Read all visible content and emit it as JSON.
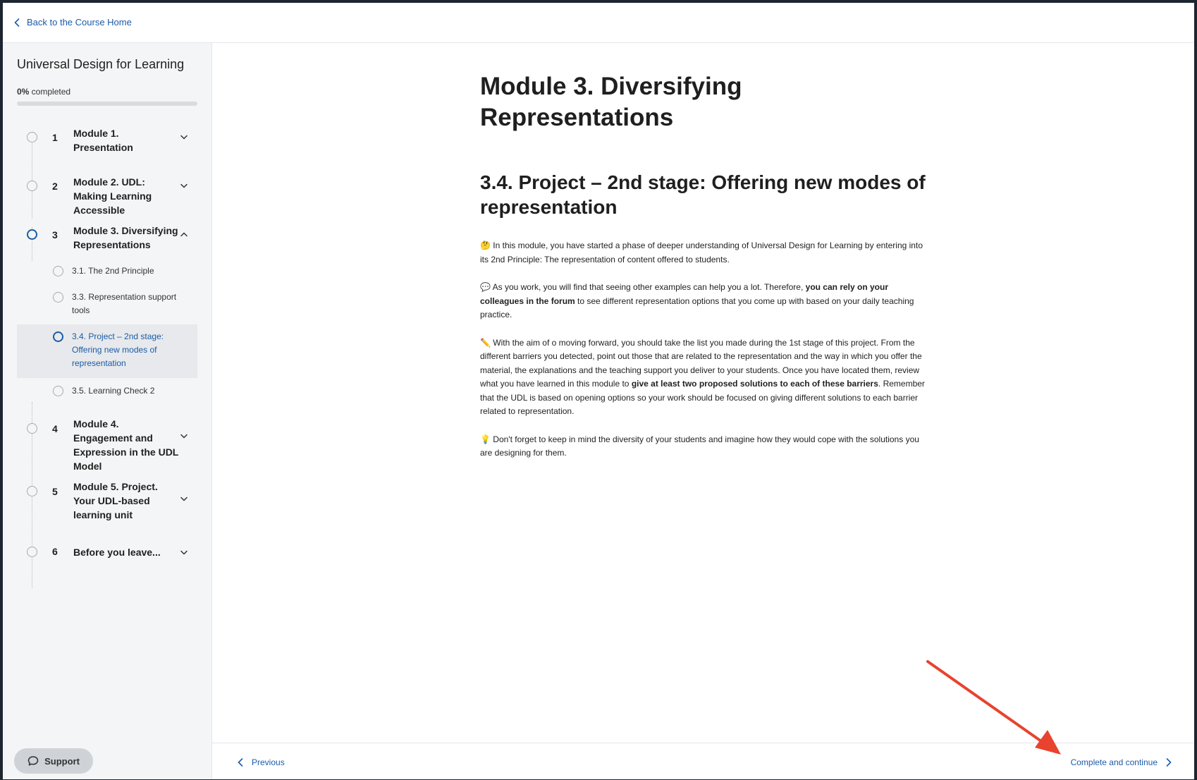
{
  "topbar": {
    "back_label": "Back to the Course Home"
  },
  "sidebar": {
    "course_title": "Universal Design for Learning",
    "progress_percent": "0%",
    "progress_suffix": " completed",
    "progress_value": 0,
    "modules": [
      {
        "num": "1",
        "title": "Module 1. Presentation",
        "expanded": false
      },
      {
        "num": "2",
        "title": "Module 2. UDL: Making Learning Accessible",
        "expanded": false
      },
      {
        "num": "3",
        "title": "Module 3. Diversifying Representations",
        "expanded": true
      },
      {
        "num": "4",
        "title": "Module 4. Engagement and Expression in the UDL Model",
        "expanded": false
      },
      {
        "num": "5",
        "title": "Module 5. Project. Your UDL-based learning unit",
        "expanded": false
      },
      {
        "num": "6",
        "title": "Before you leave...",
        "expanded": false
      }
    ],
    "lessons": [
      {
        "title": "3.1. The 2nd Principle"
      },
      {
        "title": "3.3. Representation support tools"
      },
      {
        "title": "3.4. Project – 2nd stage: Offering new modes of representation",
        "current": true
      },
      {
        "title": "3.5. Learning Check 2"
      }
    ],
    "support_label": "Support"
  },
  "main": {
    "module_title": "Module 3. Diversifying Representations",
    "lesson_title": "3.4. Project – 2nd stage: Offering new modes of representation",
    "paragraphs": {
      "p1": "🤔 In this module, you have started a phase of deeper understanding of Universal Design for Learning by entering into its 2nd Principle: The representation of content offered to students.",
      "p2_a": "💬 As you work, you will find that seeing other examples can help you a lot. Therefore, ",
      "p2_b": "you can rely on your colleagues in the forum",
      "p2_c": " to see different representation options that you come up with based on your daily teaching practice.",
      "p3_a": "✏️ With the aim of o moving forward, you should take the list you made during the 1st stage of this project. From the different barriers you detected, point out those that are related to the representation and the way in which you offer the material, the explanations and the teaching support you deliver to your students. Once you have located them, review what you have learned in this module to ",
      "p3_b": "give at least two proposed solutions to each of these barriers",
      "p3_c": ". Remember that the UDL is based on opening options so your work should be focused on giving different solutions to each barrier related to representation.",
      "p4": "💡 Don't forget to keep in mind the diversity of  your students and imagine how they would cope with the solutions you are designing for them."
    }
  },
  "footer": {
    "previous_label": "Previous",
    "next_label": "Complete and continue"
  },
  "colors": {
    "accent": "#1c5ba8",
    "annotation_arrow": "#e8432e"
  }
}
